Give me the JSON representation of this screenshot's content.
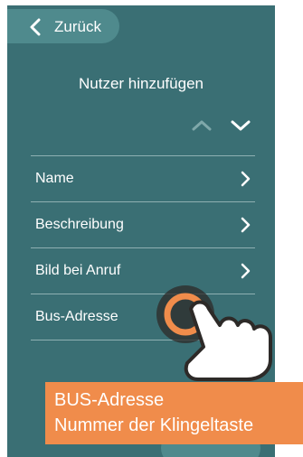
{
  "header": {
    "back_label": "Zurück"
  },
  "page": {
    "title": "Nutzer hinzufügen"
  },
  "list": {
    "items": [
      {
        "label": "Name"
      },
      {
        "label": "Beschreibung"
      },
      {
        "label": "Bild bei Anruf"
      },
      {
        "label": "Bus-Adresse"
      }
    ]
  },
  "callout": {
    "line1": "BUS-Adresse",
    "line2": "Nummer der Klingeltaste"
  },
  "colors": {
    "screen_bg": "#3a6f74",
    "button_bg": "#4f8a8d",
    "callout_bg": "#f08c4b",
    "touch_ring": "#f08c4b"
  },
  "icons": {
    "back": "chevron-left-icon",
    "up": "chevron-up-icon",
    "down": "chevron-down-icon",
    "item": "chevron-right-icon",
    "touch": "pointing-hand-icon"
  }
}
